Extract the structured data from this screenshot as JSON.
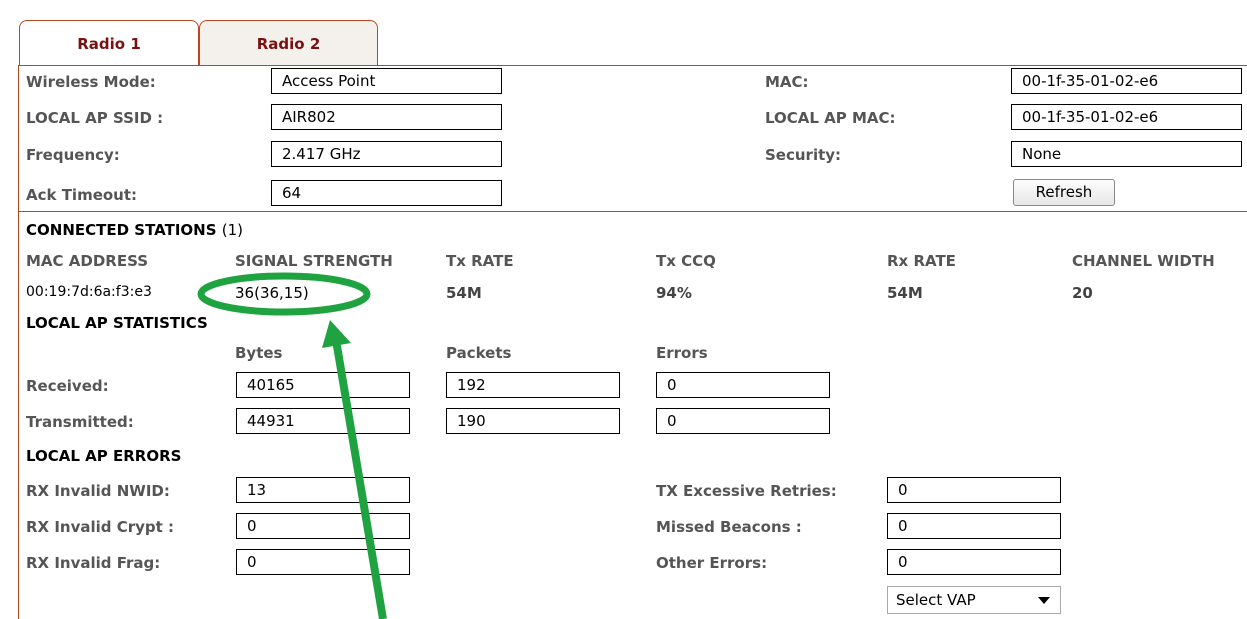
{
  "tabs": [
    {
      "label": "Radio 1"
    },
    {
      "label": "Radio 2"
    }
  ],
  "wireless": {
    "mode_label": "Wireless Mode:",
    "mode_value": "Access Point",
    "ssid_label": "LOCAL AP SSID :",
    "ssid_value": "AIR802",
    "freq_label": "Frequency:",
    "freq_value": "2.417 GHz",
    "ack_label": "Ack Timeout:",
    "ack_value": "64",
    "mac_label": "MAC:",
    "mac_value": "00-1f-35-01-02-e6",
    "apmac_label": "LOCAL AP MAC:",
    "apmac_value": "00-1f-35-01-02-e6",
    "security_label": "Security:",
    "security_value": "None",
    "refresh_label": "Refresh"
  },
  "stations": {
    "title": "CONNECTED STATIONS",
    "count": "(1)",
    "headers": [
      "MAC ADDRESS",
      "SIGNAL STRENGTH",
      "Tx RATE",
      "Tx CCQ",
      "Rx RATE",
      "CHANNEL WIDTH"
    ],
    "row": [
      "00:19:7d:6a:f3:e3",
      "36(36,15)",
      "54M",
      "94%",
      "54M",
      "20"
    ]
  },
  "stats": {
    "title": "LOCAL AP STATISTICS",
    "col_bytes": "Bytes",
    "col_packets": "Packets",
    "col_errors": "Errors",
    "received_label": "Received:",
    "received": [
      "40165",
      "192",
      "0"
    ],
    "transmitted_label": "Transmitted:",
    "transmitted": [
      "44931",
      "190",
      "0"
    ]
  },
  "errors": {
    "title": "LOCAL AP ERRORS",
    "nwid_label": "RX Invalid NWID:",
    "nwid_value": "13",
    "crypt_label": "RX Invalid Crypt :",
    "crypt_value": "0",
    "frag_label": "RX Invalid Frag:",
    "frag_value": "0",
    "retries_label": "TX Excessive Retries:",
    "retries_value": "0",
    "beacons_label": "Missed Beacons :",
    "beacons_value": "0",
    "other_label": "Other Errors:",
    "other_value": "0"
  },
  "vap_select": {
    "selected": "Select VAP"
  },
  "colors": {
    "border": "#b8481f",
    "tab_text": "#7a1010",
    "highlight": "#1fa341"
  }
}
